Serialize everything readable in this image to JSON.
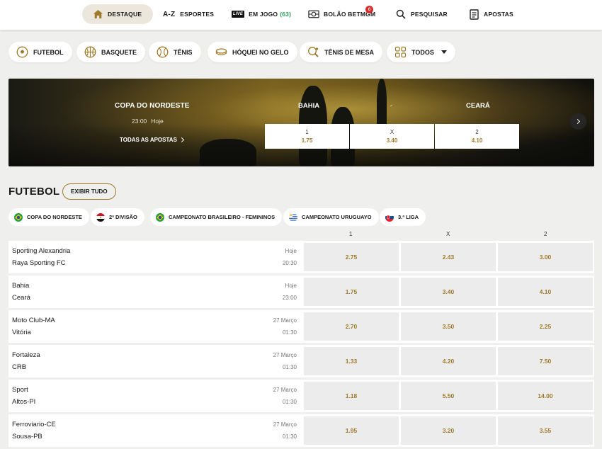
{
  "nav": {
    "items": [
      {
        "label": "DESTAQUE",
        "icon": "home-icon"
      },
      {
        "label": "ESPORTES",
        "icon": "az-icon",
        "icon_text": "A-Z"
      },
      {
        "label": "EM JOGO",
        "icon": "live-icon",
        "icon_text": "LIVE",
        "count": "(63)"
      },
      {
        "label": "BOLÃO BETMGM",
        "icon": "pool-icon",
        "badge": "0"
      },
      {
        "label": "PESQUISAR",
        "icon": "search-icon"
      },
      {
        "label": "APOSTAS",
        "icon": "betslip-icon"
      }
    ]
  },
  "sports": [
    {
      "label": "FUTEBOL",
      "icon": "soccer-ball-icon"
    },
    {
      "label": "BASQUETE",
      "icon": "basketball-icon"
    },
    {
      "label": "TÊNIS",
      "icon": "tennis-ball-icon"
    },
    {
      "label": "HÓQUEI NO GELO",
      "icon": "hockey-puck-icon"
    },
    {
      "label": "TÊNIS DE MESA",
      "icon": "table-tennis-icon"
    },
    {
      "label": "TODOS",
      "icon": "grid-icon"
    }
  ],
  "banner": {
    "league": "COPA DO NORDESTE",
    "time": "23:00",
    "day": "Hoje",
    "all_bets": "TODAS AS APOSTAS",
    "home": "BAHIA",
    "dash": "-",
    "away": "CEARÁ",
    "odds": [
      {
        "label": "1",
        "value": "1.75"
      },
      {
        "label": "X",
        "value": "3.40"
      },
      {
        "label": "2",
        "value": "4.10"
      }
    ]
  },
  "section": {
    "title": "FUTEBOL",
    "show_all": "EXIBIR TUDO"
  },
  "leagues": [
    {
      "label": "COPA DO NORDESTE",
      "flag": "brazil-flag-icon"
    },
    {
      "label": "2ª DIVISÃO",
      "flag": "egypt-flag-icon"
    },
    {
      "label": "CAMPEONATO BRASILEIRO - FEMININOS",
      "flag": "brazil-flag-icon"
    },
    {
      "label": "CAMPEONATO URUGUAYO",
      "flag": "uruguay-flag-icon"
    },
    {
      "label": "3.ª LIGA",
      "flag": "slovakia-flag-icon"
    }
  ],
  "columns": [
    "1",
    "X",
    "2"
  ],
  "matches": [
    {
      "home": "Sporting Alexandria",
      "away": "Raya Sporting FC",
      "day": "Hoje",
      "time": "20:30",
      "odds": [
        "2.75",
        "2.43",
        "3.00"
      ]
    },
    {
      "home": "Bahia",
      "away": "Ceará",
      "day": "Hoje",
      "time": "23:00",
      "odds": [
        "1.75",
        "3.40",
        "4.10"
      ]
    },
    {
      "home": "Moto Club-MA",
      "away": "Vitória",
      "day": "27 Março",
      "time": "01:30",
      "odds": [
        "2.70",
        "3.50",
        "2.25"
      ]
    },
    {
      "home": "Fortaleza",
      "away": "CRB",
      "day": "27 Março",
      "time": "01:30",
      "odds": [
        "1.33",
        "4.20",
        "7.50"
      ]
    },
    {
      "home": "Sport",
      "away": "Altos-PI",
      "day": "27 Março",
      "time": "01:30",
      "odds": [
        "1.18",
        "5.50",
        "14.00"
      ]
    },
    {
      "home": "Ferroviario-CE",
      "away": "Sousa-PB",
      "day": "27 Março",
      "time": "01:30",
      "odds": [
        "1.95",
        "3.20",
        "3.55"
      ]
    }
  ],
  "colors": {
    "accent": "#a07a2a",
    "live_count": "#2a9a5a",
    "notification": "#d62f2f"
  }
}
